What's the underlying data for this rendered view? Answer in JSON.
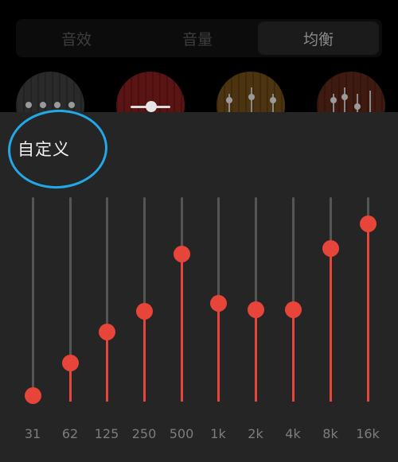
{
  "tabs": [
    {
      "label": "音效",
      "active": false
    },
    {
      "label": "音量",
      "active": false
    },
    {
      "label": "均衡",
      "active": true
    }
  ],
  "presets": [
    {
      "color": "#2a2a2a",
      "icon": "eq-knobs-icon"
    },
    {
      "color": "#5a1414",
      "icon": "balance-icon"
    },
    {
      "color": "#4b340f",
      "icon": "eq-sliders-icon"
    },
    {
      "color": "#3e1a10",
      "icon": "eq-sliders-icon"
    }
  ],
  "custom": {
    "title": "自定义",
    "annotation_color": "#22a8e6"
  },
  "equalizer": {
    "accent_color": "#e8453a",
    "track_color": "#555555",
    "bands": [
      {
        "label": "31",
        "level": 0.03
      },
      {
        "label": "62",
        "level": 0.19
      },
      {
        "label": "125",
        "level": 0.34
      },
      {
        "label": "250",
        "level": 0.44
      },
      {
        "label": "500",
        "level": 0.72
      },
      {
        "label": "1k",
        "level": 0.48
      },
      {
        "label": "2k",
        "level": 0.45
      },
      {
        "label": "4k",
        "level": 0.45
      },
      {
        "label": "8k",
        "level": 0.75
      },
      {
        "label": "16k",
        "level": 0.87
      }
    ]
  }
}
